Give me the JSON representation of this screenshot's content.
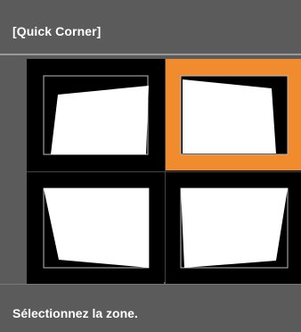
{
  "header": {
    "title": "[Quick Corner]"
  },
  "zones": [
    {
      "id": "top-left",
      "selected": false
    },
    {
      "id": "top-right",
      "selected": true
    },
    {
      "id": "bottom-left",
      "selected": false
    },
    {
      "id": "bottom-right",
      "selected": false
    }
  ],
  "footer": {
    "prompt": "Sélectionnez la zone."
  },
  "colors": {
    "panel": "#5b5b5b",
    "selection": "#f08c2e",
    "screen": "#ffffff",
    "background": "#000000"
  }
}
